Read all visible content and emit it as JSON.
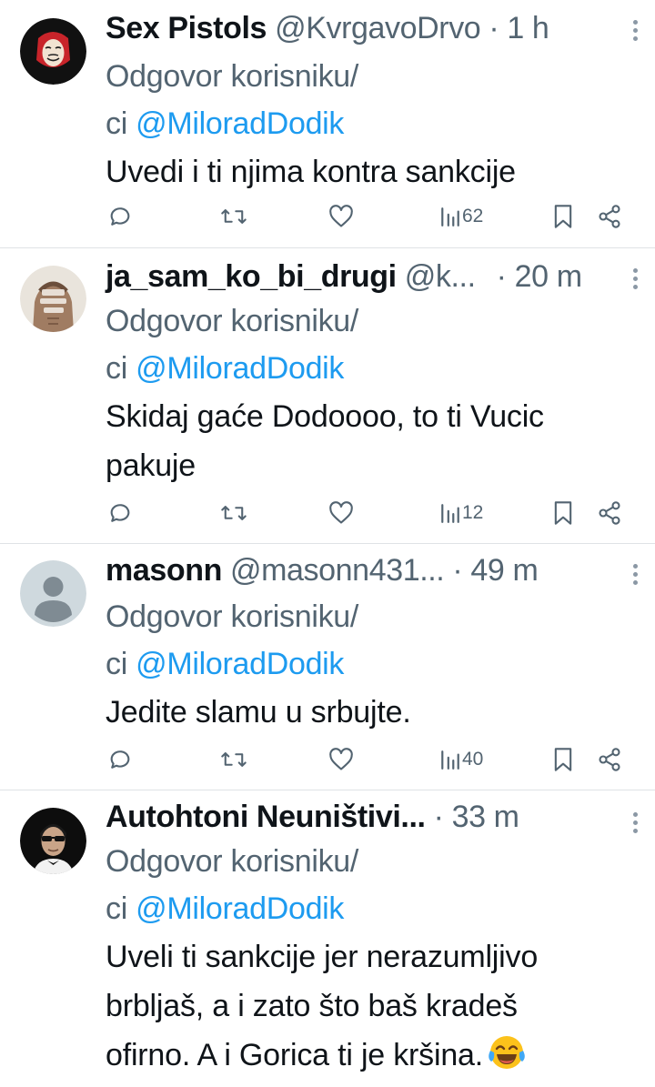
{
  "reply_prefix_1": "Odgovor korisniku/",
  "reply_prefix_2": "ci ",
  "reply_mention": "@MiloradDodik",
  "separator_dot": "·",
  "tweets": [
    {
      "name": "Sex Pistols",
      "handle": "@KvrgavoDrvo",
      "time": "1 h",
      "text_lines": [
        "Uvedi i ti njima kontra sankcije"
      ],
      "views": "62",
      "avatar": "money-heist-mask-avatar"
    },
    {
      "name": "ja_sam_ko_bi_drugi",
      "handle": "@k...",
      "time": "20 m",
      "text_lines": [
        "Skidaj gaće Dodoooo, to ti Vucic",
        "pakuje"
      ],
      "views": "12",
      "avatar": "torso-photo-avatar"
    },
    {
      "name": "masonn",
      "handle": "@masonn431...",
      "time": "49 m",
      "text_lines": [
        "Jedite slamu u srbujte."
      ],
      "views": "40",
      "avatar": "default-user-avatar"
    },
    {
      "name": "Autohtoni Neuništivi...",
      "handle": "",
      "time": "33 m",
      "text_lines": [
        "Uveli ti sankcije jer nerazumljivo",
        "brbljaš, a i zato što baš kradeš",
        "ofirno. A i Gorica ti je kršina."
      ],
      "views": "",
      "avatar": "man-sunglasses-avatar",
      "emoji": "face-with-tears-of-joy"
    }
  ],
  "colors": {
    "text": "#0f1419",
    "secondary": "#536471",
    "link": "#1d9bf0",
    "divider": "#dfe3e6"
  }
}
